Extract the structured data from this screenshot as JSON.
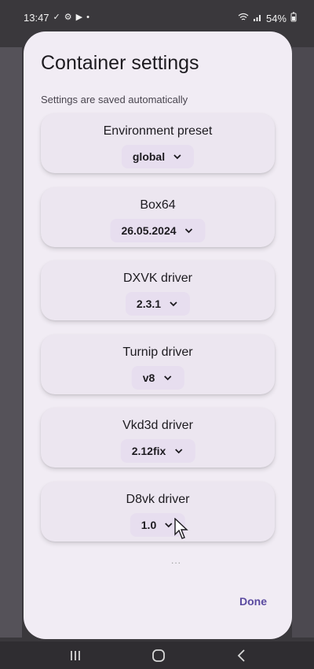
{
  "status": {
    "time": "13:47",
    "battery": "54%"
  },
  "dialog": {
    "title": "Container settings",
    "subtitle": "Settings are saved automatically",
    "done_label": "Done",
    "more_indicator": "..."
  },
  "settings": [
    {
      "label": "Environment preset",
      "value": "global"
    },
    {
      "label": "Box64",
      "value": "26.05.2024"
    },
    {
      "label": "DXVK driver",
      "value": "2.3.1"
    },
    {
      "label": "Turnip driver",
      "value": "v8"
    },
    {
      "label": "Vkd3d driver",
      "value": "2.12fix"
    },
    {
      "label": "D8vk driver",
      "value": "1.0"
    }
  ],
  "icons": {
    "status_left": [
      "check-icon",
      "gear-icon",
      "youtube-icon",
      "dot-icon"
    ],
    "status_right": [
      "wifi-icon",
      "signal-icon",
      "battery-icon"
    ],
    "nav": [
      "recents-icon",
      "home-icon",
      "back-icon"
    ],
    "dropdown": "chevron-down-icon"
  },
  "colors": {
    "accent": "#5a4aa0",
    "dialog_bg": "#f1ecf4",
    "card_bg": "#ece6f0"
  }
}
